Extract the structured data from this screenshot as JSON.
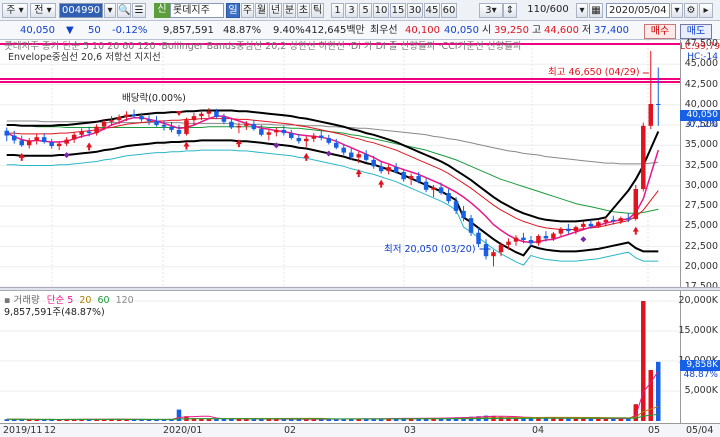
{
  "toolbar": {
    "type_select": "주",
    "period_select": "전",
    "code": "004990",
    "credit_badge": "신",
    "name": "롯데지주",
    "tabs": [
      "일",
      "주",
      "월",
      "년",
      "분",
      "초",
      "틱",
      "1",
      "3",
      "5",
      "10",
      "15",
      "30",
      "45",
      "60"
    ],
    "active_tab": "일",
    "count_select": "3",
    "range": "110/600",
    "date": "2020/05/04"
  },
  "info": {
    "price": "40,050",
    "change": "50",
    "change_pct": "-0.12%",
    "volume": "9,857,591",
    "turnover_pct": "48.87%",
    "ratio": "9.40%",
    "amount": "412,645백만",
    "best_ask_label": "최우선",
    "best_ask": "40,100",
    "best_bid": "40,050",
    "open_label": "시",
    "open": "39,250",
    "high_label": "고",
    "high": "44,600",
    "low_label": "저",
    "low": "37,400",
    "buy_button": "매수",
    "sell_button": "매도"
  },
  "price_panel": {
    "legend_line1": "롯데지주   종가  단순 5  10  20  60  120  ·Bollinger Bands중심선 20,2  상한선  하한선  ·Di 가 DI 즐 신향돌파  ·CCI기준선 신향돌파",
    "legend_line2": "Envelope중심선 20,6   저항선   지지선",
    "annotation_high": "최고 46,650 (04/29)",
    "annotation_low": "최저 20,050 (03/20)",
    "annotation_dividend": "배당락(0.00%)",
    "right_tags": {
      "lc": "LC:99,79",
      "hc": "HC:-14",
      "current": "40,050",
      "current_pct": "-0.12%"
    },
    "y_labels": [
      "47,500",
      "45,000",
      "42,500",
      "40,000",
      "37,500",
      "35,000",
      "32,500",
      "30,000",
      "27,500",
      "25,000",
      "22,500",
      "20,000",
      "17,500"
    ]
  },
  "volume_panel": {
    "legend_label": "거래량",
    "legend_ma": "단순",
    "legend_periods": [
      "5",
      "20",
      "60",
      "120"
    ],
    "value_text": "9,857,591주(48.87%)",
    "y_labels": [
      "20,000K",
      "15,000K",
      "10,000K",
      "5,000K"
    ],
    "current_tag": "9,858K",
    "current_pct": "48.87%"
  },
  "x_axis": {
    "labels": [
      "2019/11",
      "12",
      "2020/01",
      "02",
      "03",
      "04",
      "05",
      "05/04"
    ]
  },
  "colors": {
    "up": "#e0141e",
    "down": "#1560e6",
    "ma5": "#e8178a",
    "ma20": "#b08000",
    "ma60": "#1a9a3a",
    "ma120": "#888888",
    "bb": "#000000",
    "env": "#2ab7c8",
    "resist": "#f00080"
  },
  "chart_data": {
    "type": "candlestick",
    "title": "롯데지주",
    "ylim": [
      17500,
      48000
    ],
    "ohlc": [
      [
        36800,
        37200,
        35500,
        36200
      ],
      [
        36200,
        36800,
        35200,
        35600
      ],
      [
        35600,
        36200,
        34800,
        35000
      ],
      [
        35000,
        35900,
        34600,
        35600
      ],
      [
        35600,
        36400,
        35100,
        36000
      ],
      [
        36000,
        36500,
        35200,
        35400
      ],
      [
        35400,
        35800,
        34600,
        34900
      ],
      [
        34900,
        35500,
        34400,
        35200
      ],
      [
        35200,
        36000,
        34900,
        35700
      ],
      [
        35700,
        36600,
        35300,
        36300
      ],
      [
        36300,
        37100,
        35900,
        36700
      ],
      [
        36700,
        37300,
        36100,
        36500
      ],
      [
        36500,
        37600,
        36200,
        37300
      ],
      [
        37300,
        38200,
        36900,
        37900
      ],
      [
        37900,
        38600,
        37400,
        38100
      ],
      [
        38100,
        38800,
        37600,
        38500
      ],
      [
        38500,
        39200,
        38000,
        38800
      ],
      [
        38800,
        39400,
        38300,
        38600
      ],
      [
        38600,
        39000,
        37900,
        38200
      ],
      [
        38200,
        38700,
        37500,
        38000
      ],
      [
        38000,
        38600,
        37300,
        37500
      ],
      [
        37500,
        38100,
        36800,
        37300
      ],
      [
        37300,
        37900,
        36600,
        36900
      ],
      [
        36900,
        37500,
        36100,
        36400
      ],
      [
        36400,
        38400,
        36200,
        38100
      ],
      [
        38100,
        39000,
        37500,
        38600
      ],
      [
        38600,
        39300,
        38100,
        38900
      ],
      [
        38900,
        39600,
        38400,
        39200
      ],
      [
        39200,
        39500,
        38300,
        38500
      ],
      [
        38500,
        38900,
        37600,
        37900
      ],
      [
        37900,
        38400,
        37000,
        37200
      ],
      [
        37200,
        37800,
        36500,
        37400
      ],
      [
        37400,
        38000,
        36900,
        37600
      ],
      [
        37600,
        38100,
        36800,
        37000
      ],
      [
        37000,
        37500,
        36100,
        36300
      ],
      [
        36300,
        36900,
        35600,
        36600
      ],
      [
        36600,
        37200,
        36100,
        36900
      ],
      [
        36900,
        37400,
        36200,
        36500
      ],
      [
        36500,
        36900,
        35700,
        35900
      ],
      [
        35900,
        36400,
        35200,
        35500
      ],
      [
        35500,
        36100,
        34800,
        35800
      ],
      [
        35800,
        36500,
        35400,
        36200
      ],
      [
        36200,
        36800,
        35600,
        35900
      ],
      [
        35900,
        36300,
        35100,
        35300
      ],
      [
        35300,
        35800,
        34500,
        34700
      ],
      [
        34700,
        35200,
        33800,
        34100
      ],
      [
        34100,
        34600,
        33200,
        33500
      ],
      [
        33500,
        34200,
        32800,
        33900
      ],
      [
        33900,
        34400,
        33000,
        33200
      ],
      [
        33200,
        33700,
        32100,
        32400
      ],
      [
        32400,
        32900,
        31500,
        31800
      ],
      [
        31800,
        32600,
        31400,
        32300
      ],
      [
        32300,
        32800,
        31500,
        31700
      ],
      [
        31700,
        32100,
        30500,
        30800
      ],
      [
        30800,
        31500,
        30100,
        31200
      ],
      [
        31200,
        31700,
        30300,
        30500
      ],
      [
        30500,
        30900,
        29200,
        29500
      ],
      [
        29500,
        30100,
        28600,
        29800
      ],
      [
        29800,
        30400,
        28900,
        29100
      ],
      [
        29100,
        29600,
        27800,
        28100
      ],
      [
        28100,
        28600,
        26500,
        26900
      ],
      [
        26900,
        27500,
        25600,
        26000
      ],
      [
        26000,
        26400,
        23800,
        24200
      ],
      [
        24200,
        24800,
        22400,
        22800
      ],
      [
        22800,
        23400,
        20900,
        21300
      ],
      [
        21300,
        22100,
        20050,
        21800
      ],
      [
        21800,
        23000,
        21300,
        22700
      ],
      [
        22700,
        23500,
        22100,
        23100
      ],
      [
        23100,
        23900,
        22600,
        23600
      ],
      [
        23600,
        24200,
        22900,
        23300
      ],
      [
        23300,
        23800,
        22500,
        22900
      ],
      [
        22900,
        24000,
        22600,
        23800
      ],
      [
        23800,
        24400,
        23100,
        23500
      ],
      [
        23500,
        24300,
        23200,
        24100
      ],
      [
        24100,
        24900,
        23800,
        24700
      ],
      [
        24700,
        25300,
        24100,
        24400
      ],
      [
        24400,
        25100,
        24000,
        24900
      ],
      [
        24900,
        25600,
        24500,
        25300
      ],
      [
        25300,
        25800,
        24700,
        25000
      ],
      [
        25000,
        25700,
        24800,
        25500
      ],
      [
        25500,
        26100,
        25000,
        25800
      ],
      [
        25800,
        26300,
        25200,
        25600
      ],
      [
        25600,
        26200,
        25300,
        26000
      ],
      [
        26000,
        26600,
        25500,
        25900
      ],
      [
        25900,
        30100,
        25700,
        29600
      ],
      [
        29600,
        37800,
        29300,
        37400
      ],
      [
        37400,
        46650,
        37000,
        40100
      ],
      [
        40100,
        44600,
        37400,
        40050
      ]
    ],
    "volume": [
      300,
      260,
      280,
      240,
      250,
      230,
      260,
      240,
      270,
      290,
      310,
      280,
      300,
      330,
      290,
      270,
      260,
      250,
      240,
      230,
      250,
      240,
      260,
      1900,
      800,
      500,
      420,
      380,
      360,
      330,
      340,
      320,
      310,
      330,
      350,
      320,
      300,
      290,
      310,
      330,
      300,
      290,
      310,
      330,
      350,
      380,
      360,
      340,
      400,
      420,
      390,
      410,
      440,
      470,
      450,
      430,
      480,
      520,
      500,
      540,
      600,
      650,
      720,
      800,
      900,
      850,
      700,
      620,
      580,
      540,
      520,
      500,
      480,
      470,
      460,
      450,
      440,
      430,
      420,
      410,
      400,
      420,
      430,
      440,
      2800,
      20000,
      8500,
      9858
    ],
    "volume_ylim": [
      0,
      21000
    ],
    "series": [
      {
        "name": "5",
        "values": [
          36500,
          36100,
          35700,
          35500,
          35600,
          35500,
          35400,
          35400,
          35500,
          35800,
          36100,
          36300,
          36600,
          37000,
          37500,
          37800,
          38200,
          38400,
          38400,
          38200,
          38000,
          37700,
          37400,
          37100,
          37200,
          37500,
          37900,
          38300,
          38600,
          38600,
          38300,
          38000,
          37700,
          37400,
          37100,
          37000,
          36800,
          36700,
          36500,
          36300,
          36200,
          36100,
          36000,
          35800,
          35500,
          35100,
          34700,
          34300,
          33900,
          33500,
          33000,
          32700,
          32300,
          32000,
          31700,
          31400,
          31000,
          30600,
          30200,
          29700,
          29200,
          28600,
          27900,
          27100,
          26200,
          25200,
          24500,
          23900,
          23400,
          23100,
          23000,
          23100,
          23300,
          23400,
          23700,
          24000,
          24300,
          24600,
          24900,
          25100,
          25400,
          25600,
          25800,
          25900,
          26700,
          28400,
          31400,
          34400
        ]
      },
      {
        "name": "20",
        "values": [
          36000,
          36000,
          35900,
          35900,
          35900,
          35900,
          35900,
          36000,
          36000,
          36100,
          36200,
          36300,
          36400,
          36600,
          36700,
          36900,
          37100,
          37200,
          37300,
          37400,
          37500,
          37500,
          37600,
          37600,
          37700,
          37700,
          37800,
          37800,
          37800,
          37800,
          37800,
          37700,
          37700,
          37600,
          37500,
          37400,
          37300,
          37200,
          37100,
          36900,
          36800,
          36600,
          36400,
          36200,
          36000,
          35800,
          35500,
          35300,
          35000,
          34800,
          34500,
          34200,
          33900,
          33500,
          33100,
          32700,
          32300,
          31900,
          31500,
          31000,
          30400,
          29800,
          29200,
          28500,
          27800,
          27100,
          26500,
          26000,
          25500,
          25100,
          24800,
          24500,
          24300,
          24200,
          24100,
          24100,
          24100,
          24200,
          24300,
          24400,
          24600,
          24800,
          25000,
          25200,
          25700,
          26500,
          27700,
          28900
        ]
      },
      {
        "name": "60",
        "values": [
          37500,
          37500,
          37400,
          37400,
          37300,
          37300,
          37300,
          37300,
          37200,
          37200,
          37200,
          37200,
          37200,
          37200,
          37200,
          37200,
          37200,
          37200,
          37200,
          37200,
          37200,
          37200,
          37200,
          37200,
          37200,
          37200,
          37200,
          37300,
          37300,
          37300,
          37300,
          37300,
          37300,
          37300,
          37300,
          37200,
          37200,
          37200,
          37100,
          37100,
          37000,
          36900,
          36800,
          36700,
          36600,
          36500,
          36300,
          36200,
          36000,
          35800,
          35600,
          35400,
          35200,
          35000,
          34800,
          34600,
          34400,
          34100,
          33800,
          33500,
          33200,
          32800,
          32400,
          32000,
          31600,
          31200,
          30800,
          30500,
          30200,
          29900,
          29600,
          29300,
          29000,
          28700,
          28400,
          28100,
          27800,
          27600,
          27400,
          27200,
          27000,
          26800,
          26700,
          26600,
          26600,
          26700,
          26900,
          27100
        ]
      },
      {
        "name": "120",
        "values": [
          38000,
          38000,
          38000,
          38000,
          38000,
          37900,
          37900,
          37900,
          37900,
          37900,
          37900,
          37900,
          37900,
          37800,
          37800,
          37800,
          37800,
          37800,
          37800,
          37800,
          37800,
          37800,
          37800,
          37800,
          37700,
          37700,
          37700,
          37700,
          37700,
          37700,
          37700,
          37600,
          37600,
          37600,
          37600,
          37600,
          37500,
          37500,
          37500,
          37500,
          37400,
          37400,
          37400,
          37300,
          37300,
          37200,
          37200,
          37100,
          37100,
          37000,
          36900,
          36800,
          36700,
          36600,
          36500,
          36400,
          36300,
          36100,
          36000,
          35800,
          35700,
          35500,
          35300,
          35100,
          34900,
          34700,
          34500,
          34300,
          34200,
          34000,
          33900,
          33800,
          33600,
          33500,
          33400,
          33300,
          33200,
          33100,
          33000,
          32900,
          32800,
          32800,
          32700,
          32700,
          32700,
          32700,
          32800,
          32900
        ]
      }
    ]
  }
}
